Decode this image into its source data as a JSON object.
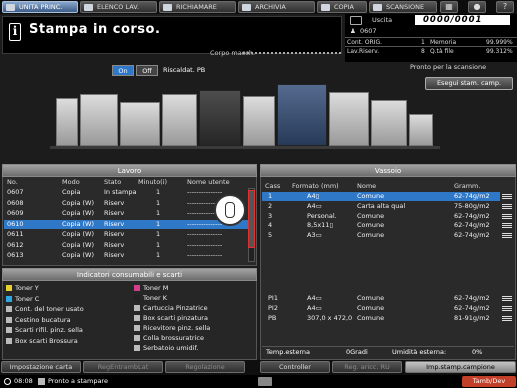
{
  "top_tabs": [
    {
      "label": "UNITA PRINC.",
      "active": true
    },
    {
      "label": "ELENCO LAV.",
      "active": false
    },
    {
      "label": "RICHIAMARE",
      "active": false
    },
    {
      "label": "ARCHIVIA",
      "active": false
    },
    {
      "label": "COPIA",
      "active": false
    },
    {
      "label": "SCANSIONE",
      "active": false
    }
  ],
  "top_icons": [
    "grid-icon",
    "dot-icon",
    "help-icon"
  ],
  "status": {
    "title": "Stampa in corso.",
    "corpo": "Corpo macch."
  },
  "right_panel": {
    "uscita_label": "Uscita",
    "uscita_value": "0000/0001",
    "user": "0607",
    "cont_orig_label": "Cont. ORIG.",
    "cont_orig_value": "1",
    "memoria_label": "Memoria",
    "memoria_value": "99.999%",
    "lav_riserv_label": "Lav.Riserv.",
    "lav_riserv_value": "8",
    "q_file_label": "Q.tà file",
    "q_file_value": "99.312%",
    "pronto_scansione": "Pronto per la scansione"
  },
  "machine": {
    "on_label": "On",
    "off_label": "Off",
    "riscaldat": "Riscaldat. PB",
    "esegui_label": "Esegui stam. camp."
  },
  "lavoro": {
    "title": "Lavoro",
    "headers": [
      "No.",
      "Modo",
      "Stato",
      "Minuto(i)",
      "Nome utente"
    ],
    "rows": [
      [
        "0607",
        "Copia",
        "In stampa",
        "1",
        "---------------"
      ],
      [
        "0608",
        "Copia (W)",
        "Riserv",
        "1",
        "---------------"
      ],
      [
        "0609",
        "Copia (W)",
        "Riserv",
        "1",
        "---------------"
      ],
      [
        "0610",
        "Copia (W)",
        "Riserv",
        "1",
        "---------------"
      ],
      [
        "0611",
        "Copia (W)",
        "Riserv",
        "1",
        "---------------"
      ],
      [
        "0612",
        "Copia (W)",
        "Riserv",
        "1",
        "---------------"
      ],
      [
        "0613",
        "Copia (W)",
        "Riserv",
        "1",
        "---------------"
      ]
    ],
    "selected_index": 3
  },
  "vassoio": {
    "title": "Vassoio",
    "headers": [
      "Cass",
      "Formato (mm)",
      "Nome",
      "Gramm."
    ],
    "rows": [
      [
        "1",
        "A4▯",
        "Comune",
        "62-74g/m2"
      ],
      [
        "2",
        "A4▭",
        "Carta alta qual",
        "75-80g/m2"
      ],
      [
        "3",
        "Personal.",
        "Comune",
        "62-74g/m2"
      ],
      [
        "4",
        "8,5x11▯",
        "Comune",
        "62-74g/m2"
      ],
      [
        "5",
        "A3▭",
        "Comune",
        "62-74g/m2"
      ]
    ],
    "bottom_rows": [
      [
        "PI1",
        "A4▭",
        "Comune",
        "62-74g/m2"
      ],
      [
        "PI2",
        "A4▭",
        "Comune",
        "62-74g/m2"
      ],
      [
        "PB",
        "307,0 x 472,0",
        "Comune",
        "81-91g/m2"
      ]
    ],
    "selected_index": 0,
    "temp_label": "Temp.esterna",
    "temp_value": "0Gradi",
    "umidita_label": "Umidità esterna:",
    "umidita_value": "0%"
  },
  "consumabili": {
    "title": "Indicatori consumabili e scarti",
    "left": [
      "Toner Y",
      "Toner C",
      "Cont. del toner usato",
      "Cestino bucatura",
      "Scarti rifil. pinz. sella",
      "Box scarti Brossura"
    ],
    "right": [
      "Toner M",
      "Toner K",
      "Cartuccia Pinzatrice",
      "Box scarti pinzatura",
      "Ricevitore pinz. sella",
      "Colla brossuratrice",
      "Serbatoio umidif."
    ]
  },
  "bottom_tabs": [
    {
      "label": "Impostazione carta",
      "state": "normal"
    },
    {
      "label": "RegEntrambLat",
      "state": "dim"
    },
    {
      "label": "Regolazione",
      "state": "dim"
    },
    {
      "label": "Controller",
      "state": "normal"
    },
    {
      "label": "Reg. aricc. RU",
      "state": "dim"
    },
    {
      "label": "Imp.stamp.campione",
      "state": "active"
    }
  ],
  "statusline": {
    "time": "08:08",
    "ready": "Pronto a stampare",
    "tamb": "Tamb/Dev"
  }
}
